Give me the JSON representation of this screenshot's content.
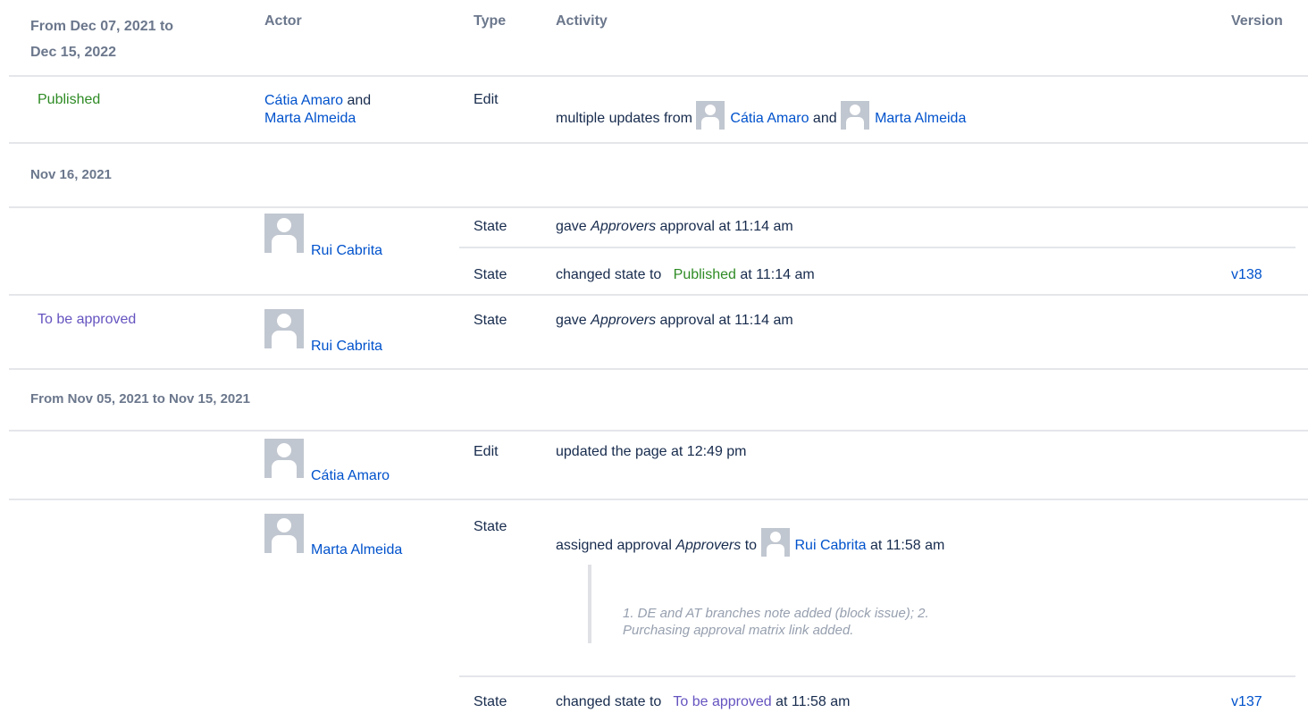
{
  "columns": {
    "date": [
      "From Dec 07, 2021 to",
      "Dec 15, 2022"
    ],
    "actor": "Actor",
    "type": "Type",
    "activity": "Activity",
    "version": "Version"
  },
  "rows": [
    {
      "status": "Published",
      "actor_line1": "Cátia Amaro",
      "actor_and": "and",
      "actor_line2": "Marta Almeida",
      "type": "Edit",
      "activity_prefix": "multiple updates from",
      "activity_user1": "Cátia Amaro",
      "activity_and": "and",
      "activity_user2": "Marta Almeida"
    }
  ],
  "groups": [
    {
      "date": "Nov 16, 2021",
      "entries": [
        {
          "actor": "Rui Cabrita",
          "items": [
            {
              "type": "State",
              "prefix": "gave",
              "italic": "Approvers",
              "suffix": "approval at 11:14 am"
            },
            {
              "type": "State",
              "prefix": "changed state to",
              "state": "Published",
              "suffix": "at 11:14 am",
              "version": "v138"
            }
          ]
        },
        {
          "status": "To be approved",
          "actor": "Rui Cabrita",
          "items": [
            {
              "type": "State",
              "prefix": "gave",
              "italic": "Approvers",
              "suffix": "approval at 11:14 am"
            }
          ]
        }
      ]
    },
    {
      "date": "From Nov 05, 2021 to Nov 15, 2021",
      "entries": [
        {
          "actor": "Cátia Amaro",
          "items": [
            {
              "type": "Edit",
              "text": "updated the page at 12:49 pm"
            }
          ]
        },
        {
          "actor": "Marta Almeida",
          "items": [
            {
              "type": "State",
              "prefix": "assigned approval",
              "italic": "Approvers",
              "to": "to",
              "user": "Rui Cabrita",
              "suffix": "at 11:58 am",
              "comment_line1": "1. DE and AT branches note added (block issue); 2.",
              "comment_line2": "Purchasing approval matrix link added."
            },
            {
              "type": "State",
              "prefix": "changed state to",
              "state": "To be approved",
              "suffix": "at 11:58 am",
              "version": "v137"
            }
          ]
        }
      ]
    }
  ],
  "colors": {
    "published": "#2e8b24",
    "to_be_approved": "#6554c0",
    "link": "#0052cc",
    "header": "#6b778c",
    "divider": "#e4e6ea"
  },
  "icons": [
    "user-avatar-icon"
  ]
}
